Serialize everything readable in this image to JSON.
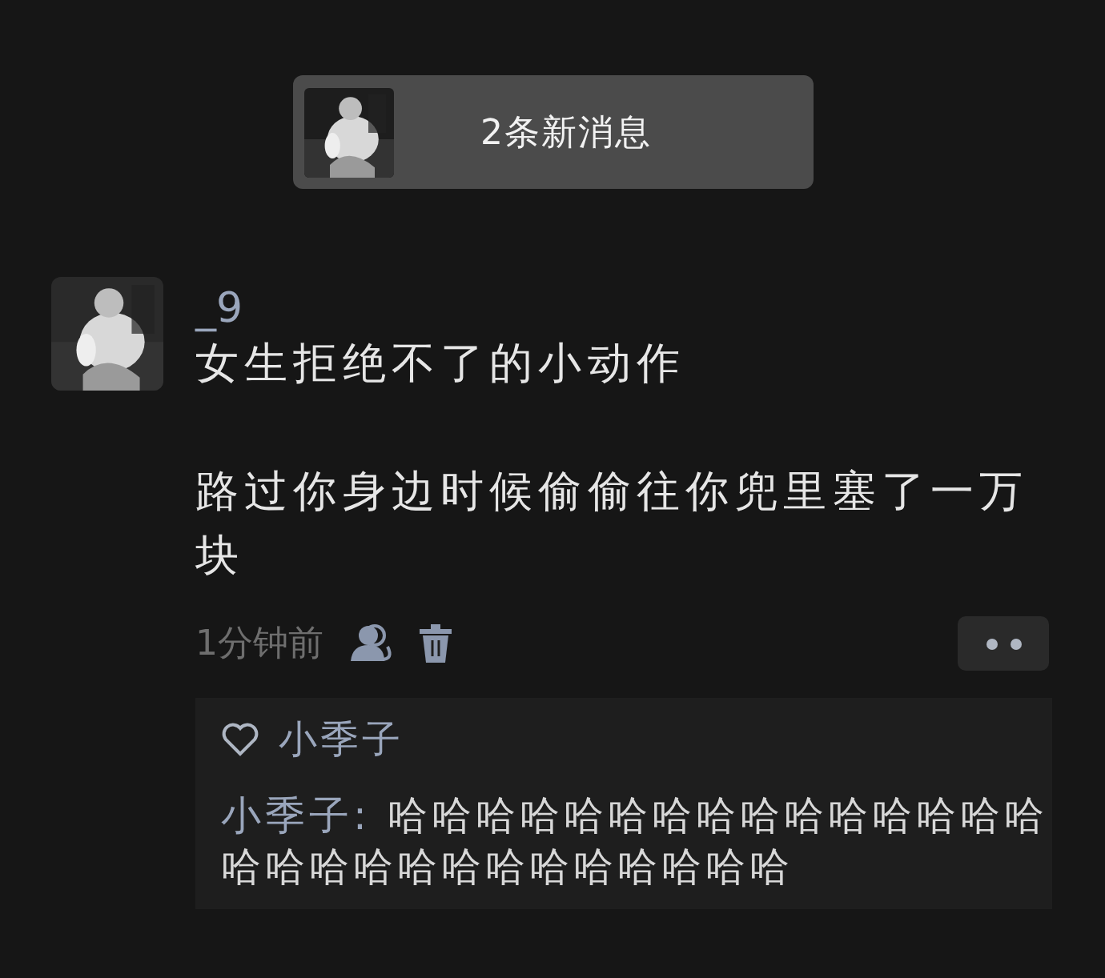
{
  "notification": {
    "text": "2条新消息"
  },
  "post": {
    "author": "_9",
    "paragraphs": [
      "女生拒绝不了的小动作",
      "路过你身边时候偷偷往你兜里塞了一万块"
    ],
    "time": "1分钟前"
  },
  "likes": [
    "小季子"
  ],
  "comments": [
    {
      "author": "小季子:",
      "text": "哈哈哈哈哈哈哈哈哈哈哈哈哈哈哈哈哈哈哈哈哈哈哈哈哈哈哈哈"
    }
  ]
}
